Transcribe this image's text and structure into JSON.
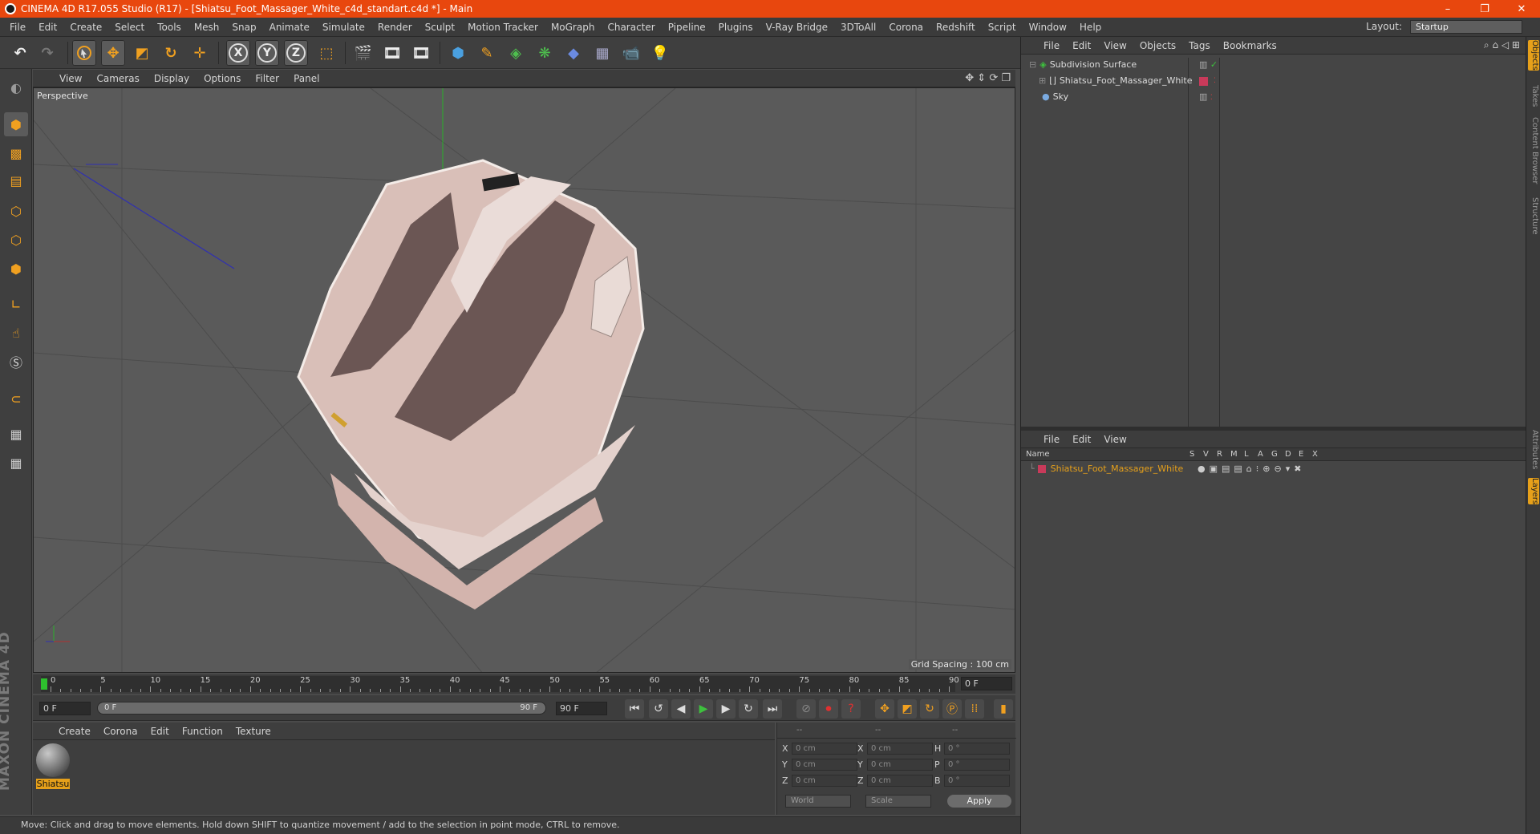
{
  "window": {
    "title": "CINEMA 4D R17.055 Studio (R17) - [Shiatsu_Foot_Massager_White_c4d_standart.c4d *] - Main"
  },
  "menu": [
    "File",
    "Edit",
    "Create",
    "Select",
    "Tools",
    "Mesh",
    "Snap",
    "Animate",
    "Simulate",
    "Render",
    "Sculpt",
    "Motion Tracker",
    "MoGraph",
    "Character",
    "Pipeline",
    "Plugins",
    "V-Ray Bridge",
    "3DToAll",
    "Corona",
    "Redshift",
    "Script",
    "Window",
    "Help"
  ],
  "layout": {
    "label": "Layout:",
    "value": "Startup"
  },
  "toolbar": {
    "x_label": "X",
    "y_label": "Y",
    "z_label": "Z"
  },
  "viewport": {
    "menu": [
      "View",
      "Cameras",
      "Display",
      "Options",
      "Filter",
      "Panel"
    ],
    "label": "Perspective",
    "grid_spacing": "Grid Spacing : 100 cm"
  },
  "timeline": {
    "ticks": [
      "0",
      "5",
      "10",
      "15",
      "20",
      "25",
      "30",
      "35",
      "40",
      "45",
      "50",
      "55",
      "60",
      "65",
      "70",
      "75",
      "80",
      "85",
      "90"
    ],
    "current_frame": "0 F"
  },
  "transport": {
    "start": "0 F",
    "slider_start": "0 F",
    "slider_end": "90 F",
    "end": "90 F"
  },
  "material_panel": {
    "menu": [
      "Create",
      "Corona",
      "Edit",
      "Function",
      "Texture"
    ],
    "material_name": "Shiatsu",
    "brand": "MAXON CINEMA 4D"
  },
  "coords": {
    "headers": [
      "--",
      "--",
      "--"
    ],
    "rows": [
      {
        "a": "X",
        "av": "0 cm",
        "b": "X",
        "bv": "0 cm",
        "c": "H",
        "cv": "0 °"
      },
      {
        "a": "Y",
        "av": "0 cm",
        "b": "Y",
        "bv": "0 cm",
        "c": "P",
        "cv": "0 °"
      },
      {
        "a": "Z",
        "av": "0 cm",
        "b": "Z",
        "bv": "0 cm",
        "c": "B",
        "cv": "0 °"
      }
    ],
    "world": "World",
    "scale": "Scale",
    "apply": "Apply"
  },
  "status": "Move: Click and drag to move elements. Hold down SHIFT to quantize movement / add to the selection in point mode, CTRL to remove.",
  "objects_panel": {
    "menu": [
      "File",
      "Edit",
      "View",
      "Objects",
      "Tags",
      "Bookmarks"
    ],
    "items": [
      "Subdivision Surface",
      "Shiatsu_Foot_Massager_White",
      "Sky"
    ]
  },
  "layers_panel": {
    "menu": [
      "File",
      "Edit",
      "View"
    ],
    "name_header": "Name",
    "columns": [
      "S",
      "V",
      "R",
      "M",
      "L",
      "A",
      "G",
      "D",
      "E",
      "X"
    ],
    "layer_name": "Shiatsu_Foot_Massager_White",
    "layer_color": "#e6a01a"
  },
  "side_tabs": [
    "Objects",
    "Takes",
    "Content Browser",
    "Structure",
    "Attributes",
    "Layers"
  ]
}
